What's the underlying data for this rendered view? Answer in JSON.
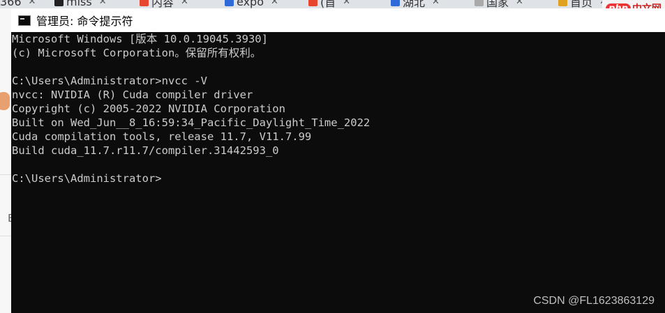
{
  "background_tabs": [
    {
      "label": "366",
      "icon": "generic-page-icon",
      "icon_color": "#777777"
    },
    {
      "label": "miss",
      "icon": "github-icon",
      "icon_color": "#222222"
    },
    {
      "label": "内容",
      "icon": "c-logo-icon",
      "icon_color": "#e8452f"
    },
    {
      "label": "expo",
      "icon": "paw-icon",
      "icon_color": "#2f6bd8"
    },
    {
      "label": "(首",
      "icon": "c-logo-icon",
      "icon_color": "#e8452f"
    },
    {
      "label": "湖北",
      "icon": "paw-icon",
      "icon_color": "#2f6bd8"
    },
    {
      "label": "国家",
      "icon": "globe-icon",
      "icon_color": "#aaaaaa"
    },
    {
      "label": "首页",
      "icon": "star-icon",
      "icon_color": "#e0a020"
    }
  ],
  "logo": {
    "php": "php",
    "text": "中文网"
  },
  "left_strip_glyph": "E",
  "window": {
    "title": "管理员: 命令提示符",
    "console_lines": [
      "Microsoft Windows [版本 10.0.19045.3930]",
      "(c) Microsoft Corporation。保留所有权利。",
      "",
      "C:\\Users\\Administrator>nvcc -V",
      "nvcc: NVIDIA (R) Cuda compiler driver",
      "Copyright (c) 2005-2022 NVIDIA Corporation",
      "Built on Wed_Jun__8_16:59:34_Pacific_Daylight_Time_2022",
      "Cuda compilation tools, release 11.7, V11.7.99",
      "Build cuda_11.7.r11.7/compiler.31442593_0",
      "",
      "C:\\Users\\Administrator>"
    ]
  },
  "watermark": "CSDN @FL1623863129",
  "colors": {
    "console_bg": "#0c0c0c",
    "console_text": "#cccccc"
  }
}
